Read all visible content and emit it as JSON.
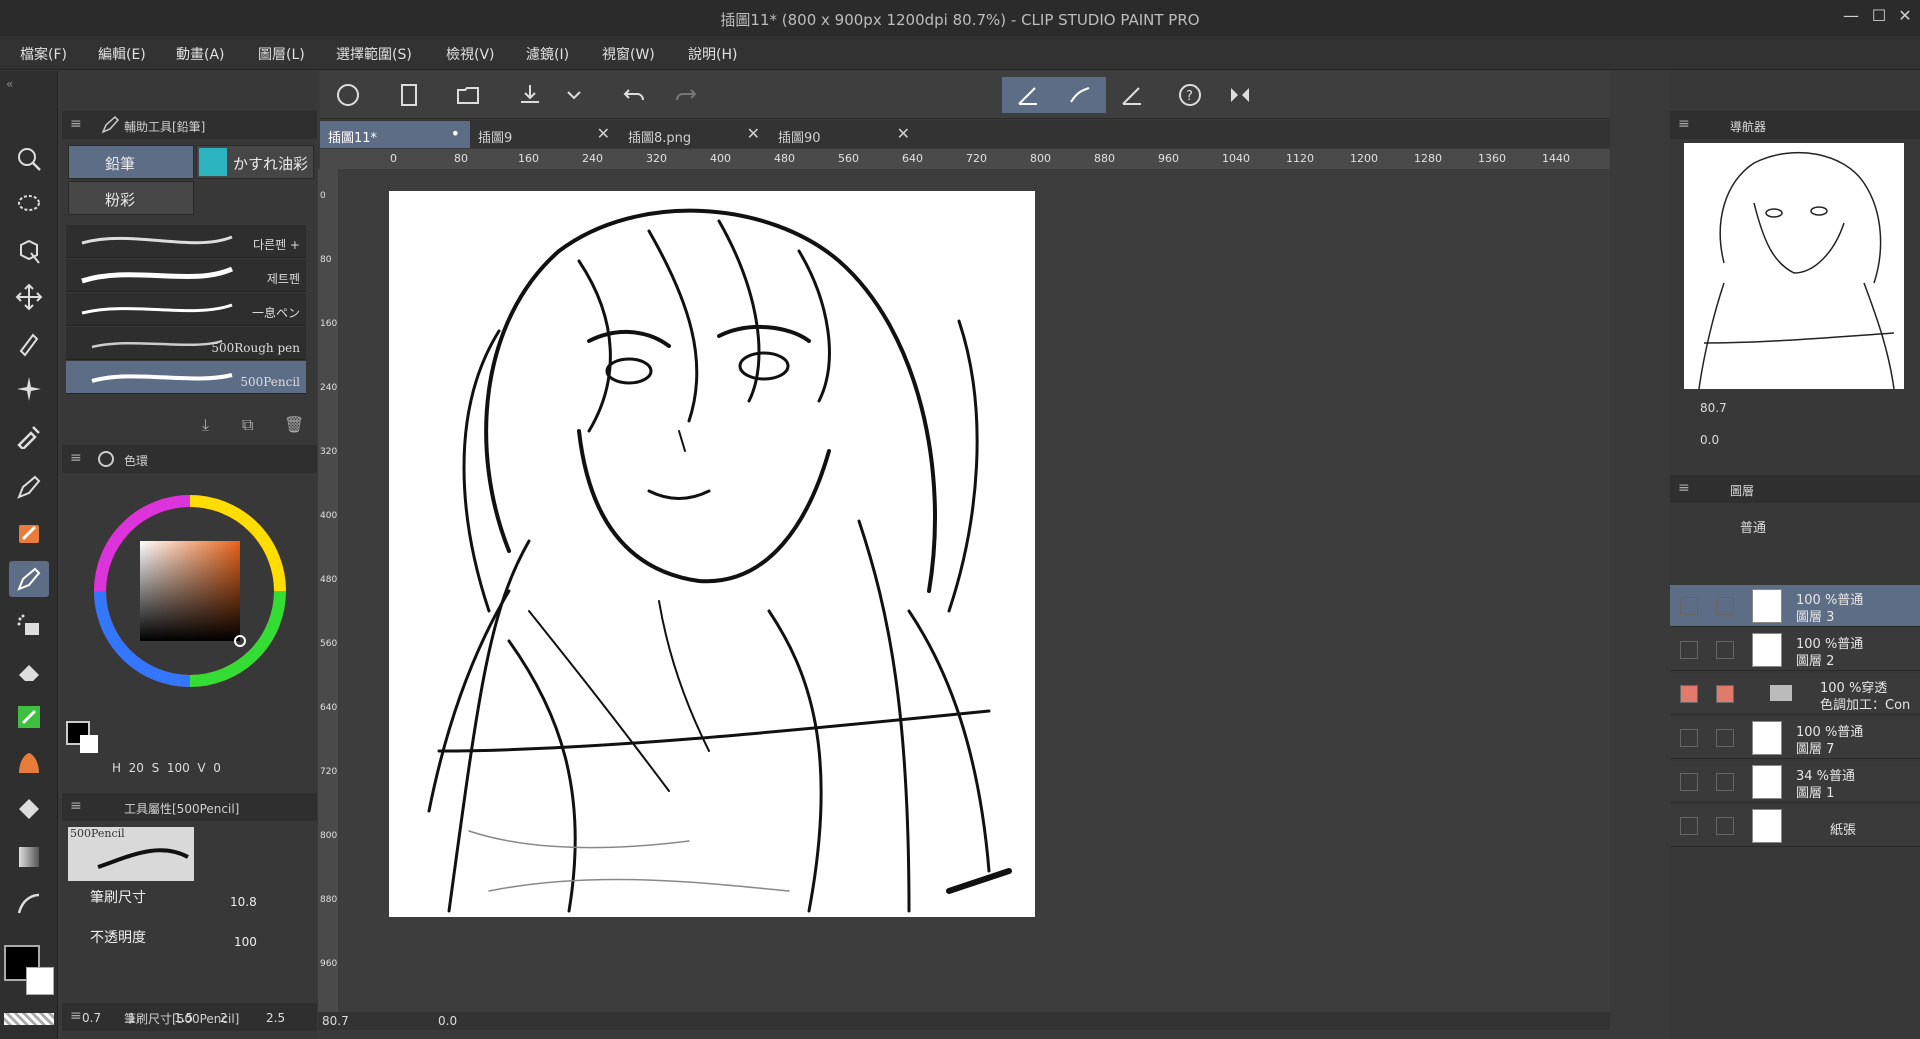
{
  "window": {
    "title": "插圖11* (800 x 900px 1200dpi 80.7%)  - CLIP STUDIO PAINT PRO"
  },
  "menu": [
    "檔案(F)",
    "編輯(E)",
    "動畫(A)",
    "圖層(L)",
    "選擇範圍(S)",
    "檢視(V)",
    "濾鏡(I)",
    "視窗(W)",
    "說明(H)"
  ],
  "subtool": {
    "header": "輔助工具[鉛筆]",
    "tabs": [
      "鉛筆",
      "かすれ油彩",
      "粉彩"
    ],
    "brushes": [
      "다른펜 +",
      "제트펜",
      "一息ペン",
      "500Rough pen",
      "500Pencil"
    ]
  },
  "color": {
    "header": "色環",
    "h_label": "H",
    "h_value": "20",
    "s_label": "S",
    "s_value": "100",
    "v_label": "V",
    "v_value": "0"
  },
  "tool_property": {
    "header": "工具屬性[500Pencil]",
    "preview_label": "500Pencil",
    "brush_size_label": "筆刷尺寸",
    "brush_size_value": "10.8",
    "opacity_label": "不透明度",
    "opacity_value": "100"
  },
  "brush_size_panel": {
    "header": "筆刷尺寸[500Pencil]",
    "sizes": [
      "0.7",
      "1",
      "1.5",
      "2",
      "2.5"
    ]
  },
  "document_tabs": [
    {
      "label": "插圖11*",
      "selected": true
    },
    {
      "label": "插圖9",
      "selected": false
    },
    {
      "label": "插圖8.png",
      "selected": false
    },
    {
      "label": "插圖90",
      "selected": false
    }
  ],
  "ruler_h": [
    "0",
    "80",
    "160",
    "240",
    "320",
    "400",
    "480",
    "560",
    "640",
    "720",
    "800",
    "880",
    "960",
    "1040",
    "1120",
    "1200",
    "1280",
    "1360",
    "1440"
  ],
  "ruler_v": [
    "0",
    "80",
    "160",
    "240",
    "320",
    "400",
    "480",
    "560",
    "640",
    "720",
    "800",
    "880",
    "960"
  ],
  "navigator": {
    "header": "導航器",
    "zoom": "80.7",
    "rotation": "0.0"
  },
  "layers": {
    "header": "圖層",
    "blend_mode": "普通",
    "items": [
      {
        "opacity_mode": "100 %普通",
        "name": "圖層 3",
        "selected": true
      },
      {
        "opacity_mode": "100 %普通",
        "name": "圖層 2",
        "selected": false
      },
      {
        "opacity_mode": "100 %穿透",
        "name": "色調加工：Con",
        "selected": false
      },
      {
        "opacity_mode": "100 %普通",
        "name": "圖層 7",
        "selected": false
      },
      {
        "opacity_mode": "34 %普通",
        "name": "圖層 1",
        "selected": false
      },
      {
        "opacity_mode": "",
        "name": "紙張",
        "selected": false
      }
    ]
  },
  "status": {
    "zoom": "80.7",
    "rotation": "0.0"
  },
  "colors": {
    "accent": "#5e6d86",
    "panel": "#383838",
    "canvas_bg": "#3d3d3d"
  }
}
